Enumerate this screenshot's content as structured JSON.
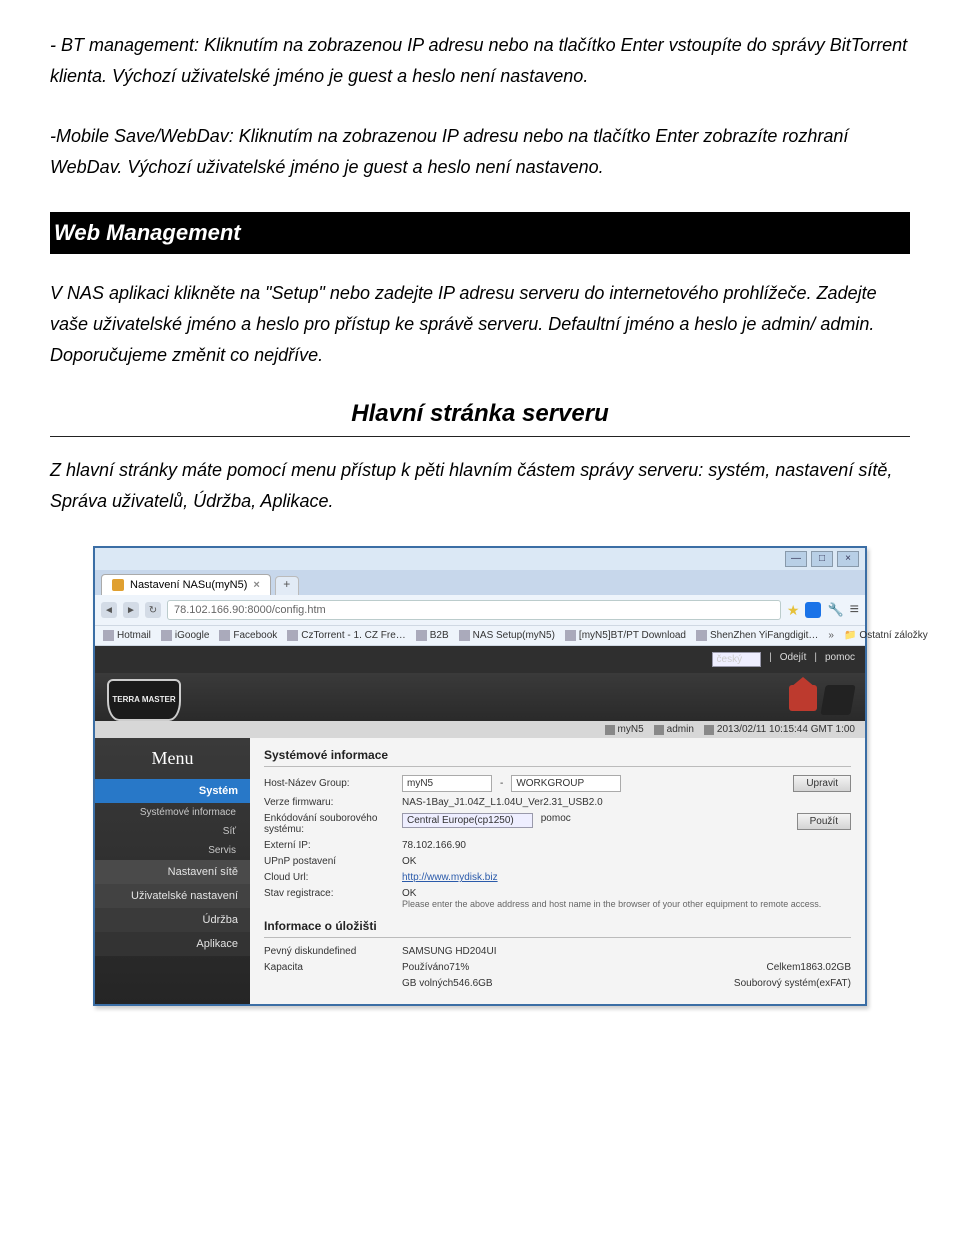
{
  "doc": {
    "p1": "- BT management: Kliknutím na zobrazenou IP adresu nebo na tlačítko Enter vstoupíte do správy BitTorrent klienta. Výchozí uživatelské jméno je guest a heslo není nastaveno.",
    "p2": "-Mobile Save/WebDav: Kliknutím na zobrazenou IP adresu nebo na tlačítko Enter zobrazíte rozhraní WebDav. Výchozí uživatelské jméno je guest a heslo není nastaveno.",
    "section": "Web Management",
    "p3": "V NAS aplikaci klikněte na \"Setup\" nebo zadejte IP adresu serveru do internetového prohlížeče. Zadejte vaše uživatelské jméno a heslo pro přístup ke správě serveru. Defaultní jméno a heslo je admin/ admin. Doporučujeme změnit co nejdříve.",
    "sub": "Hlavní stránka serveru",
    "p4": "Z hlavní stránky máte pomocí menu přístup k pěti hlavním částem správy serveru: systém, nastavení sítě, Správa uživatelů, Údržba, Aplikace."
  },
  "browser": {
    "win": [
      "—",
      "□",
      "×"
    ],
    "tab_title": "Nastavení NASu(myN5)",
    "url": "78.102.166.90:8000/config.htm",
    "bookmarks": [
      "Hotmail",
      "iGoogle",
      "Facebook",
      "CzTorrent - 1. CZ Fre…",
      "B2B",
      "NAS Setup(myN5)",
      "[myN5]BT/PT Download",
      "ShenZhen YiFangdigit…"
    ],
    "more": "»",
    "other_bm": "Ostatní záložky"
  },
  "app": {
    "lang": "český",
    "logout": "Odejít",
    "help": "pomoc",
    "logo": "TERRA MASTER",
    "status": {
      "host": "myN5",
      "user": "admin",
      "clock": "2013/02/11 10:15:44 GMT 1:00"
    },
    "menu": {
      "title": "Menu",
      "items": [
        "Systém",
        "Nastavení sítě",
        "Uživatelské nastavení",
        "Údržba",
        "Aplikace"
      ],
      "subs": [
        "Systémové informace",
        "Síť",
        "Servis"
      ]
    },
    "panel1_title": "Systémové informace",
    "rows": {
      "host_lbl": "Host-Název Group:",
      "host_val": "myN5",
      "group_val": "WORKGROUP",
      "edit_btn": "Upravit",
      "fw_lbl": "Verze firmwaru:",
      "fw_val": "NAS-1Bay_J1.04Z_L1.04U_Ver2.31_USB2.0",
      "enc_lbl": "Enkódování souborového systému:",
      "enc_val": "Central Europe(cp1250)",
      "enc_help": "pomoc",
      "apply_btn": "Použít",
      "ip_lbl": "Externí IP:",
      "ip_val": "78.102.166.90",
      "upnp_lbl": "UPnP postavení",
      "upnp_val": "OK",
      "cloud_lbl": "Cloud Url:",
      "cloud_val": "http://www.mydisk.biz",
      "reg_lbl": "Stav registrace:",
      "reg_val": "OK",
      "reg_note": "Please enter the above address and host name in the browser of your other equipment to remote access."
    },
    "panel2_title": "Informace o úložišti",
    "storage": {
      "disk_lbl": "Pevný diskundefined",
      "disk_val": "SAMSUNG HD204UI",
      "cap_lbl": "Kapacita",
      "used": "Používáno71%",
      "total": "Celkem1863.02GB",
      "free": "GB volných546.6GB",
      "fs": "Souborový systém(exFAT)"
    }
  }
}
